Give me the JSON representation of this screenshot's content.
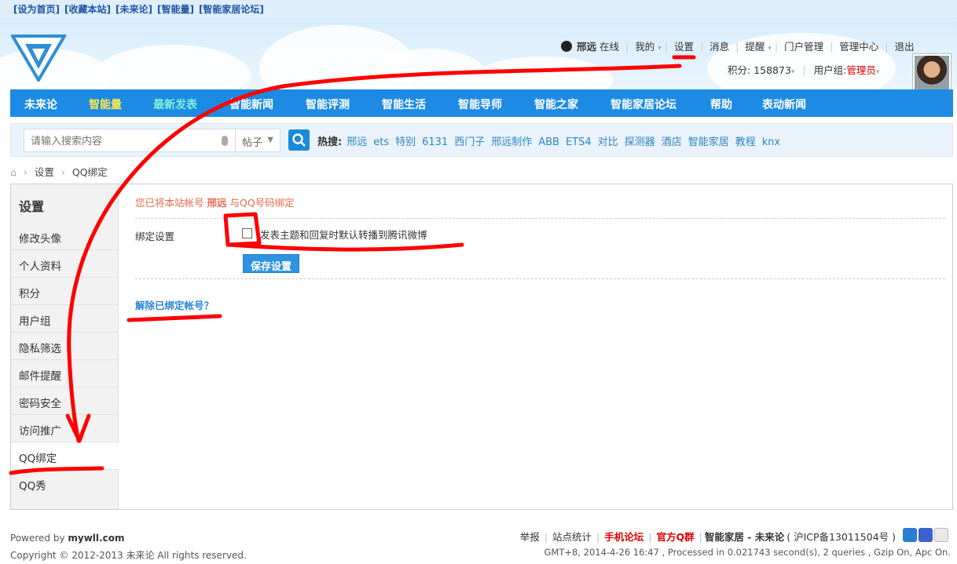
{
  "topbar": {
    "links": [
      "[设为首页]",
      "[收藏本站]",
      "[未来论]",
      "[智能量]",
      "[智能家居论坛]"
    ]
  },
  "user": {
    "name": "邢远",
    "status": "在线",
    "menu": [
      "我的",
      "设置",
      "消息",
      "提醒",
      "门户管理",
      "管理中心",
      "退出"
    ],
    "points_label": "积分: 158873",
    "group_label": "用户组:",
    "group_value": "管理员"
  },
  "nav": [
    "未来论",
    "智能量",
    "最新发表",
    "智能新闻",
    "智能评测",
    "智能生活",
    "智能导师",
    "智能之家",
    "智能家居论坛",
    "帮助",
    "表动新闻"
  ],
  "search": {
    "placeholder": "请输入搜索内容",
    "type": "帖子",
    "hot_label": "热搜:",
    "hot": [
      "邢远",
      "ets",
      "特别",
      "6131",
      "西门子",
      "邢远制作",
      "ABB",
      "ETS4",
      "对比",
      "探测器",
      "酒店",
      "智能家居",
      "教程",
      "knx"
    ]
  },
  "breadcrumb": [
    "设置",
    "QQ绑定"
  ],
  "sidebar": {
    "title": "设置",
    "items": [
      "修改头像",
      "个人资料",
      "积分",
      "用户组",
      "隐私筛选",
      "邮件提醒",
      "密码安全",
      "访问推广",
      "QQ绑定",
      "QQ秀"
    ],
    "active": "QQ绑定"
  },
  "content": {
    "notice_pre": "您已将本站帐号",
    "notice_name": "邢远",
    "notice_post": "与QQ号码绑定",
    "bind_label": "绑定设置",
    "checkbox_text": "发表主题和回复时默认转播到腾讯微博",
    "save_button": "保存设置",
    "unbind_link": "解除已绑定帐号？"
  },
  "footer": {
    "powered_pre": "Powered by",
    "powered_site": "mywll.com",
    "copyright": "Copyright © 2012-2013 未来论 All rights reserved.",
    "links": [
      "举报",
      "站点统计",
      "手机论坛",
      "官方Q群",
      "智能家居 - 未来论",
      "( 沪ICP备13011504号 )"
    ],
    "stat": "GMT+8, 2014-4-26 16:47 , Processed in 0.021743 second(s), 2 queries , Gzip On, Apc On."
  },
  "colors": {
    "nav": "#1d8ae3",
    "accent": "#2b86d3",
    "notice": "#e46a4e",
    "annotation": "#ff0000"
  }
}
